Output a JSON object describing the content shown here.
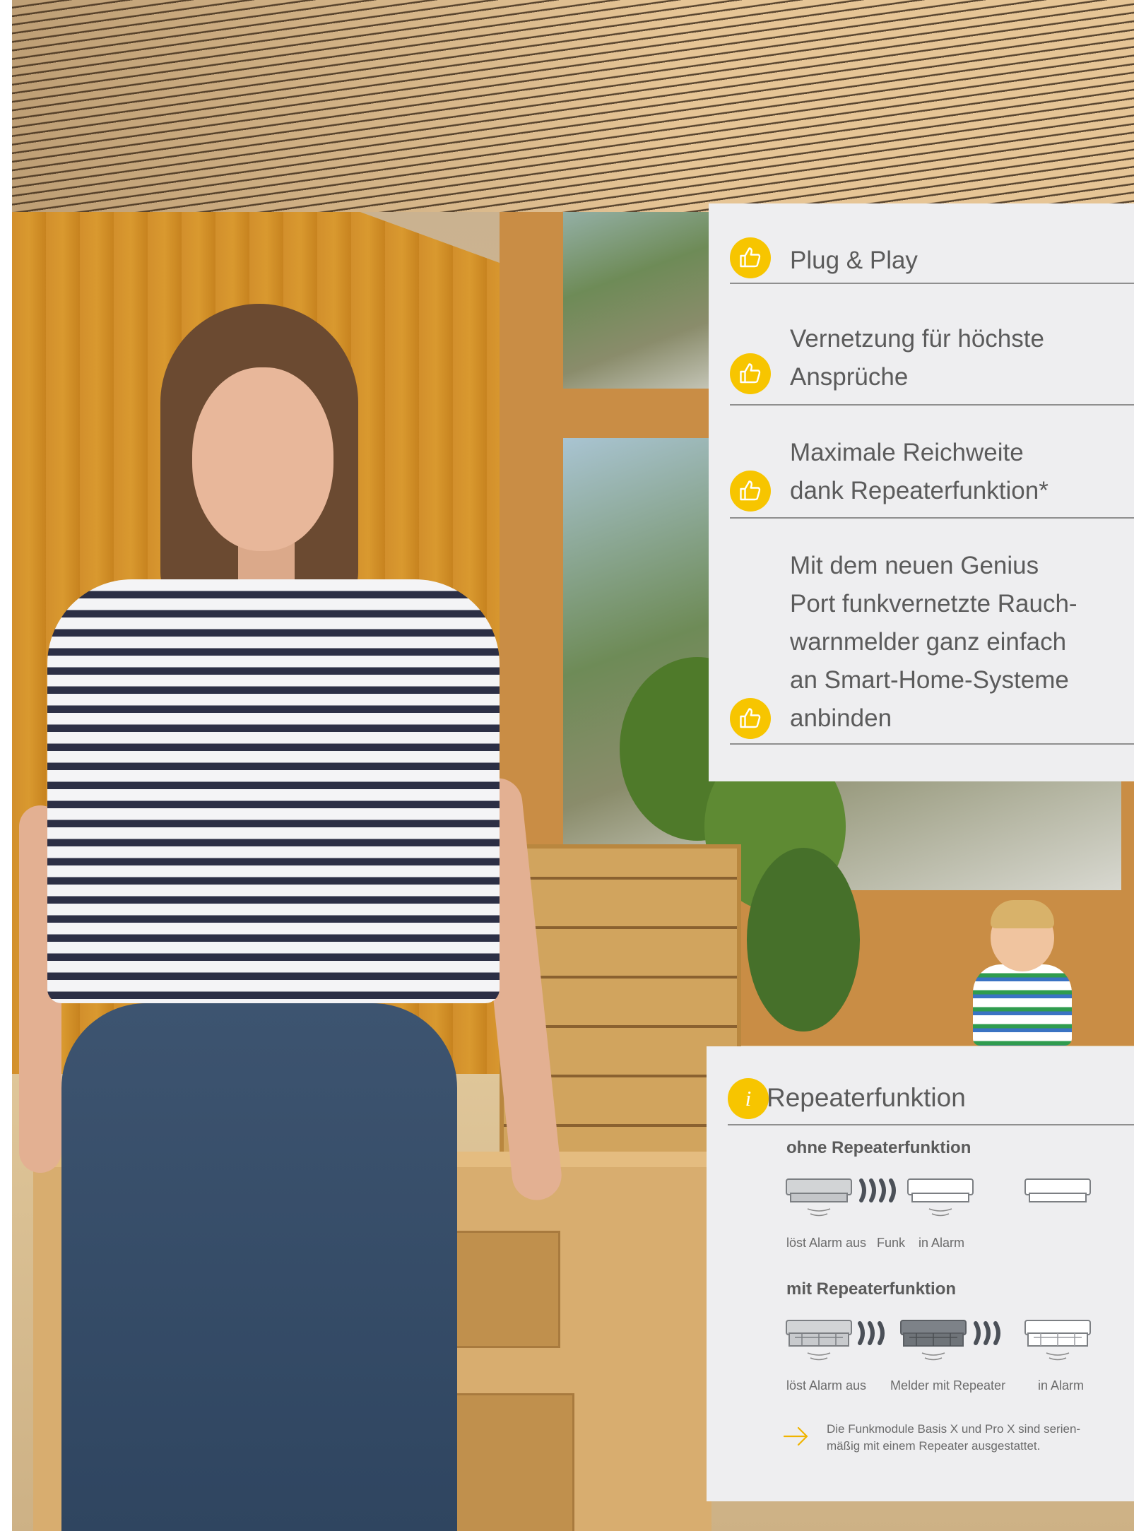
{
  "features": [
    {
      "label_line1": "Plug & Play",
      "icon": "thumbs-up-icon"
    },
    {
      "label_line1": "Vernetzung für höchste",
      "label_line2": "Ansprüche",
      "icon": "thumbs-up-icon"
    },
    {
      "label_line1": "Maximale Reichweite",
      "label_line2": "dank Repeaterfunktion*",
      "icon": "thumbs-up-icon"
    },
    {
      "label_line1": "Mit dem neuen Genius",
      "label_line2": "Port funkvernetzte Rauch-",
      "label_line3": "warnmelder ganz einfach",
      "label_line4": "an Smart-Home-Systeme",
      "label_line5": "anbinden",
      "icon": "thumbs-up-icon"
    }
  ],
  "info": {
    "icon": "info-icon",
    "title": "Repeaterfunktion",
    "without": {
      "heading": "ohne Repeaterfunktion",
      "cap_triggers": "löst Alarm aus",
      "cap_funk": "Funk",
      "cap_alarm": "in Alarm"
    },
    "with": {
      "heading": "mit Repeaterfunktion",
      "cap_triggers": "löst Alarm aus",
      "cap_repeater": "Melder mit Repeater",
      "cap_alarm": "in Alarm"
    },
    "note_line1": "Die Funkmodule Basis X und Pro X sind serien-",
    "note_line2": "mäßig mit einem Repeater ausgestattet.",
    "note_icon": "arrow-right-icon"
  },
  "colors": {
    "accent_yellow": "#f7c500",
    "panel_bg": "#eeeef0",
    "text_gray": "#5b5b5b"
  }
}
